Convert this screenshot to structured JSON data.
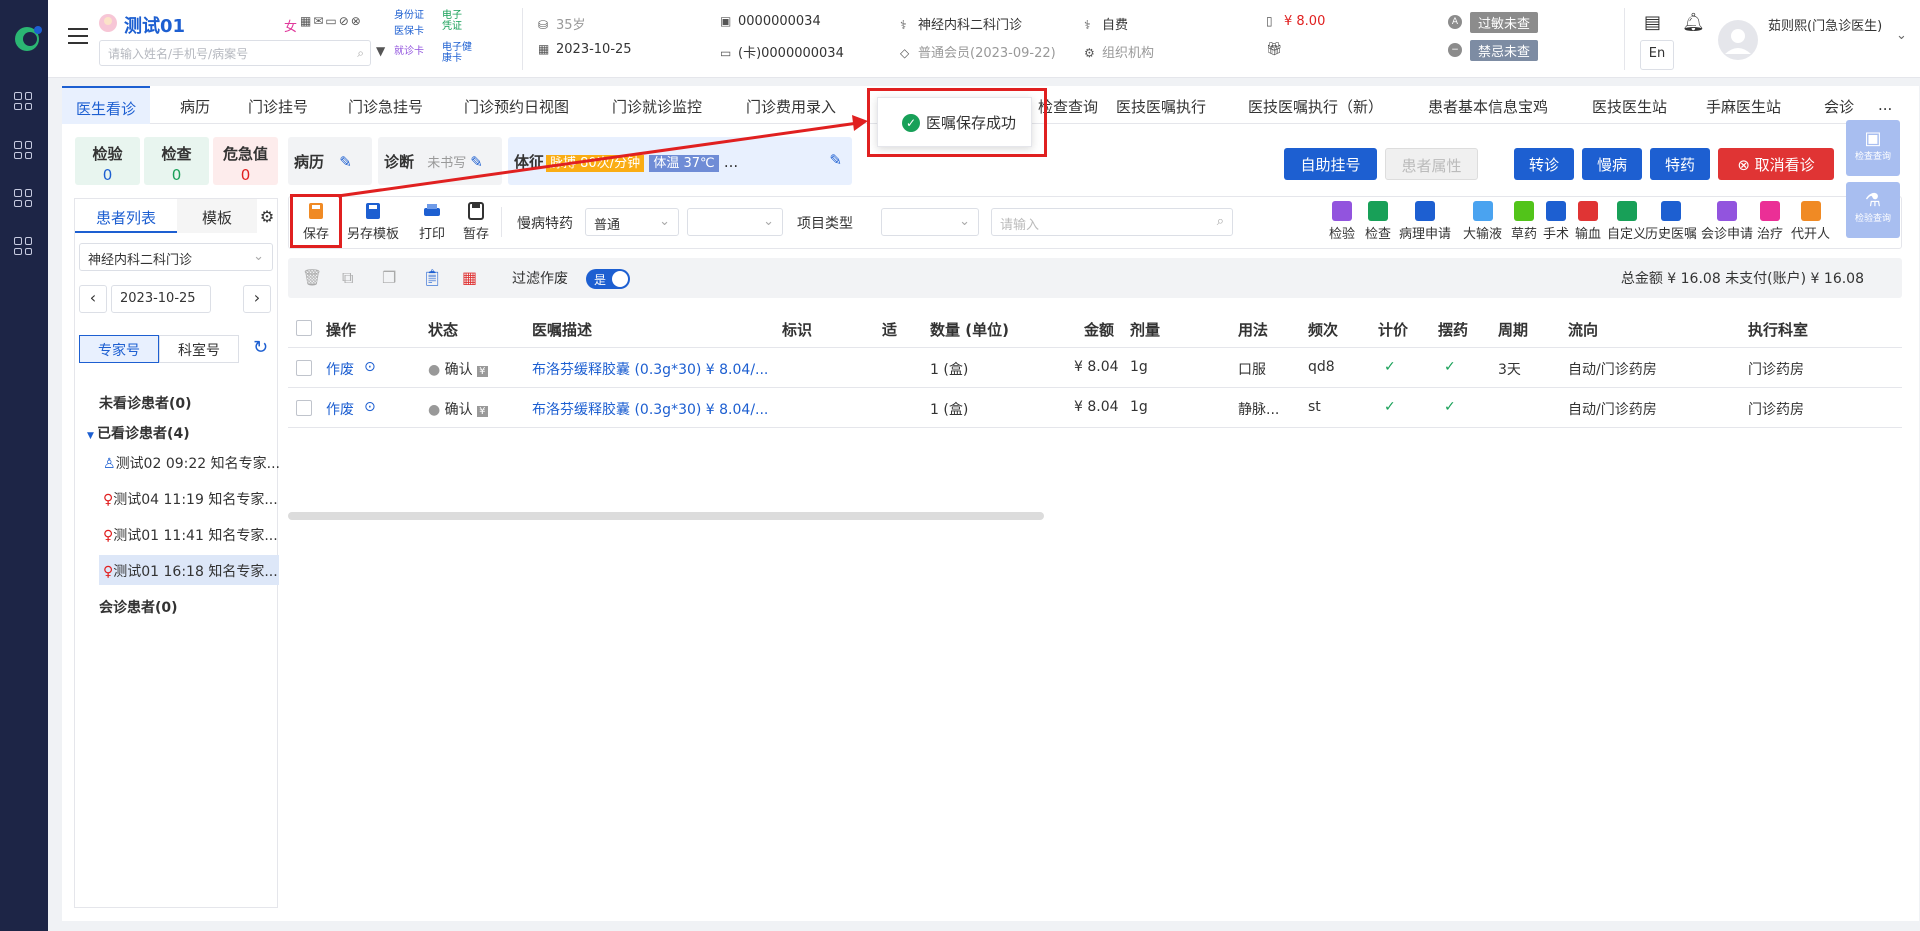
{
  "header": {
    "patient_name": "测试01",
    "gender": "女",
    "search_placeholder": "请输入姓名/手机号/病案号",
    "card_types": [
      "身份证",
      "医保卡",
      "电子凭证",
      "就诊卡",
      "电子健康卡"
    ],
    "age": "35岁",
    "visit_date": "2023-10-25",
    "patient_id": "0000000034",
    "card_no": "(卡)0000000034",
    "department": "神经内科二科门诊",
    "member": "普通会员(2023-09-22)",
    "payment_type": "自费",
    "org": "组织机构",
    "balance": "¥ 8.00",
    "allergy_tag": "过敏未查",
    "taboo_tag": "禁忌未查",
    "lang": "En",
    "user": "茹则熙(门急诊医生)"
  },
  "tabs": [
    "医生看诊",
    "病历",
    "门诊挂号",
    "门诊急挂号",
    "门诊预约日视图",
    "门诊就诊监控",
    "门诊费用录入",
    "检查查询",
    "医技医嘱执行",
    "医技医嘱执行（新）",
    "患者基本信息宝鸡",
    "医技医生站",
    "手麻医生站",
    "会诊",
    "..."
  ],
  "stats": [
    {
      "label": "检验",
      "value": "0"
    },
    {
      "label": "检查",
      "value": "0"
    },
    {
      "label": "危急值",
      "value": "0"
    }
  ],
  "record": {
    "bingli": "病历",
    "zhenduan": "诊断",
    "zhenduan_state": "未书写",
    "tizheng": "体征",
    "pulse": "脉搏 80次/分钟",
    "temp": "体温 37℃",
    "ellipsis": "..."
  },
  "actions": {
    "self_register": "自助挂号",
    "patient_attr": "患者属性",
    "transfer": "转诊",
    "chronic": "慢病",
    "special_drug": "特药",
    "cancel_visit": "取消看诊"
  },
  "left_panel": {
    "tabs": [
      "患者列表",
      "模板"
    ],
    "dept_select": "神经内科二科门诊",
    "date": "2023-10-25",
    "toggle": [
      "专家号",
      "科室号"
    ],
    "groups": {
      "unseen": "未看诊患者(0)",
      "seen": "已看诊患者(4)",
      "consult": "会诊患者(0)"
    },
    "patients": [
      "测试02 09:22 知名专家...",
      "测试04 11:19 知名专家...",
      "测试01 11:41 知名专家...",
      "测试01 16:18 知名专家..."
    ]
  },
  "toolbar": {
    "save": "保存",
    "save_template": "另存模板",
    "print": "打印",
    "hold": "暂存",
    "chronic_special_label": "慢病特药",
    "chronic_special_value": "普通",
    "item_type_label": "项目类型",
    "search_placeholder": "请输入",
    "right_buttons": [
      "检验",
      "检查",
      "病理申请",
      "大输液",
      "草药",
      "手术",
      "输血",
      "自定义",
      "历史医嘱",
      "会诊申请",
      "治疗",
      "代开人"
    ]
  },
  "actbar": {
    "filter_label": "过滤作废",
    "switch_text": "是",
    "totals": "总金额 ¥ 16.08 未支付(账户) ¥ 16.08"
  },
  "table": {
    "headers": [
      "操作",
      "状态",
      "医嘱描述",
      "标识",
      "适",
      "数量 (单位)",
      "金额",
      "剂量",
      "用法",
      "频次",
      "计价",
      "摆药",
      "周期",
      "流向",
      "执行科室"
    ],
    "rows": [
      {
        "op": "作废",
        "status": "确认",
        "desc": "布洛芬缓释胶囊 (0.3g*30)  ¥ 8.04/...",
        "qty": "1 (盒)",
        "amount": "¥ 8.04",
        "dose": "1g",
        "usage": "口服",
        "freq": "qd8",
        "period": "3天",
        "flow": "自动/门诊药房",
        "dept": "门诊药房"
      },
      {
        "op": "作废",
        "status": "确认",
        "desc": "布洛芬缓释胶囊 (0.3g*30)  ¥ 8.04/...",
        "qty": "1 (盒)",
        "amount": "¥ 8.04",
        "dose": "1g",
        "usage": "静脉...",
        "freq": "st",
        "period": "",
        "flow": "自动/门诊药房",
        "dept": "门诊药房"
      }
    ]
  },
  "toast": {
    "text": "医嘱保存成功"
  },
  "right_side": [
    "检查查询",
    "检验查询"
  ],
  "colors": {
    "primary": "#1d5fd1",
    "danger": "#e03434",
    "success": "#18a058",
    "nav": "#1d2546"
  }
}
